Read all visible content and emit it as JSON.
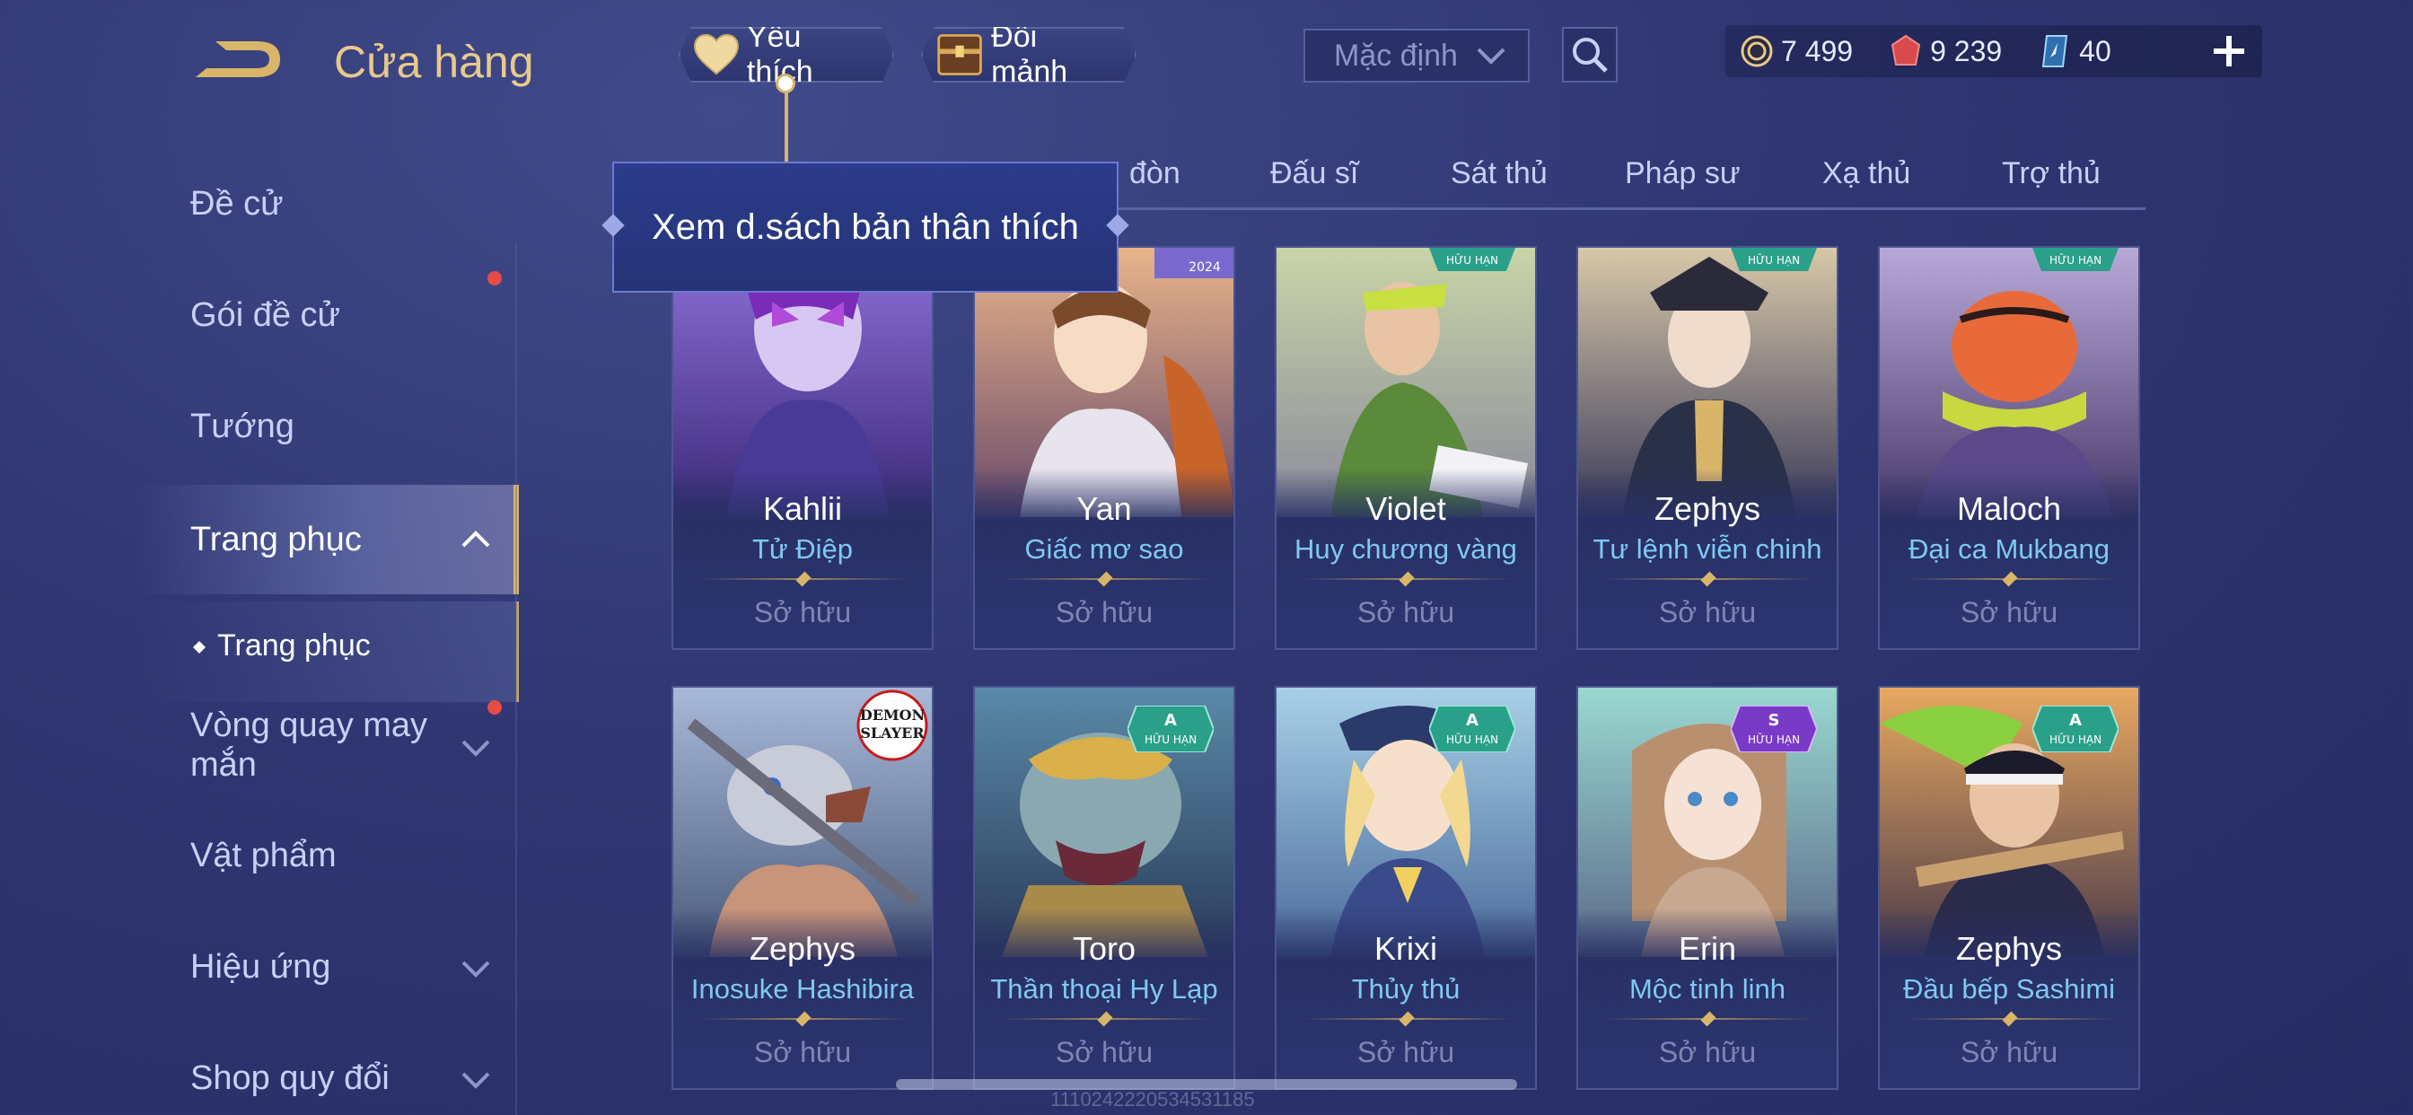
{
  "header": {
    "title": "Cửa hàng",
    "favorites_label": "Yêu thích",
    "shards_label": "Đổi mảnh",
    "sort_value": "Mặc định",
    "currencies": [
      {
        "name": "gold",
        "value": "7 499",
        "color": "#e8c98c"
      },
      {
        "name": "voucher",
        "value": "9 239",
        "color": "#e0565a"
      },
      {
        "name": "diamond",
        "value": "40",
        "color": "#7fc8f4"
      }
    ]
  },
  "tooltip": {
    "text": "Xem d.sách bản thân thích"
  },
  "sidebar": {
    "items": [
      {
        "label": "Đề cử"
      },
      {
        "label": "Gói đề cử"
      },
      {
        "label": "Tướng"
      },
      {
        "label": "Trang phục"
      },
      {
        "label": "Trang phục"
      },
      {
        "label": "Vòng quay may mắn"
      },
      {
        "label": "Vật phẩm"
      },
      {
        "label": "Hiệu ứng"
      },
      {
        "label": "Shop quy đổi"
      }
    ]
  },
  "tabs": [
    {
      "label": "đòn"
    },
    {
      "label": "Đấu sĩ"
    },
    {
      "label": "Sát thủ"
    },
    {
      "label": "Pháp sư"
    },
    {
      "label": "Xạ thủ"
    },
    {
      "label": "Trợ thủ"
    }
  ],
  "cards": [
    {
      "hero": "Kahlii",
      "skin": "Tử Điệp",
      "status": "Sở hữu"
    },
    {
      "hero": "Yan",
      "skin": "Giấc mơ sao",
      "status": "Sở hữu",
      "corner": "2024"
    },
    {
      "hero": "Violet",
      "skin": "Huy chương vàng",
      "status": "Sở hữu",
      "badge": "HỮU HẠN"
    },
    {
      "hero": "Zephys",
      "skin": "Tư lệnh viễn chinh",
      "status": "Sở hữu",
      "badge": "HỮU HẠN"
    },
    {
      "hero": "Maloch",
      "skin": "Đại ca Mukbang",
      "status": "Sở hữu",
      "badge": "HỮU HẠN"
    },
    {
      "hero": "Zephys",
      "skin": "Inosuke Hashibira",
      "status": "Sở hữu",
      "logo": "DEMON SLAYER"
    },
    {
      "hero": "Toro",
      "skin": "Thần thoại Hy Lạp",
      "status": "Sở hữu",
      "tier": "A",
      "badge": "HỮU HẠN"
    },
    {
      "hero": "Krixi",
      "skin": "Thủy thủ",
      "status": "Sở hữu",
      "tier": "A",
      "badge": "HỮU HẠN"
    },
    {
      "hero": "Erin",
      "skin": "Mộc tinh linh",
      "status": "Sở hữu",
      "tier": "S",
      "badge": "HỮU HẠN"
    },
    {
      "hero": "Zephys",
      "skin": "Đầu bếp Sashimi",
      "status": "Sở hữu",
      "tier": "A",
      "badge": "HỮU HẠN"
    }
  ],
  "watermark": "1110242220534531185"
}
